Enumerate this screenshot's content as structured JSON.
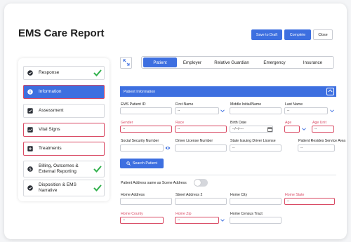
{
  "page": {
    "title": "EMS Care Report",
    "buttons": {
      "save_to_draft": "Save to Draft",
      "complete": "Complete",
      "close": "Close"
    }
  },
  "sidebar": {
    "items": [
      {
        "label": "Response",
        "icon": "check-circle-icon",
        "status": "complete"
      },
      {
        "label": "Information",
        "icon": "info-circle-icon",
        "status": "active"
      },
      {
        "label": "Assessment",
        "icon": "checkbox-icon",
        "status": "incomplete"
      },
      {
        "label": "Vital Signs",
        "icon": "chart-icon",
        "status": "error"
      },
      {
        "label": "Treatments",
        "icon": "medical-box-icon",
        "status": "error"
      },
      {
        "label": "Billing, Outcomes & External Reporting",
        "icon": "dollar-circle-icon",
        "status": "complete"
      },
      {
        "label": "Disposition & EMS Narrative",
        "icon": "check-circle-icon",
        "status": "complete"
      }
    ]
  },
  "tabs": [
    "Patient",
    "Employer",
    "Relative Guardian",
    "Emergency",
    "Insurance"
  ],
  "active_tab": "Patient",
  "section": {
    "title": "Patient Information"
  },
  "fields": {
    "ems_patient_id": {
      "label": "EMS Patient ID",
      "value": ""
    },
    "first_name": {
      "label": "First Name",
      "value": "--"
    },
    "middle_name": {
      "label": "Middle Initial/Name",
      "value": ""
    },
    "last_name": {
      "label": "Last Name",
      "value": "--"
    },
    "gender": {
      "label": "Gender",
      "value": "--"
    },
    "race": {
      "label": "Race",
      "value": "--"
    },
    "birth_date": {
      "label": "Birth Date",
      "value": "--/--/----"
    },
    "age": {
      "label": "Age",
      "value": ""
    },
    "age_unit": {
      "label": "Age Unit",
      "value": "--"
    },
    "ssn": {
      "label": "Social Security Number",
      "value": ""
    },
    "license_number": {
      "label": "Driver License Number",
      "value": ""
    },
    "license_state": {
      "label": "State Issuing Driver License",
      "value": "--"
    },
    "resides_area": {
      "label": "Patient Resides Service Area",
      "value": "--"
    },
    "home_address": {
      "label": "Home Address",
      "value": ""
    },
    "street_address_2": {
      "label": "Street Address 2",
      "value": ""
    },
    "home_city": {
      "label": "Home City",
      "value": ""
    },
    "home_state": {
      "label": "Home State",
      "value": "--"
    },
    "home_county": {
      "label": "Home County",
      "value": "--"
    },
    "home_zip": {
      "label": "Home Zip",
      "value": "--"
    },
    "census_tract": {
      "label": "Home Census Tract",
      "value": ""
    }
  },
  "search_button": "Search Patient",
  "same_as_scene": {
    "label": "Patient Address same as Scene Address",
    "on": false
  },
  "colors": {
    "accent": "#3d6fe0",
    "error": "#d94a64",
    "success": "#2fb04a"
  }
}
